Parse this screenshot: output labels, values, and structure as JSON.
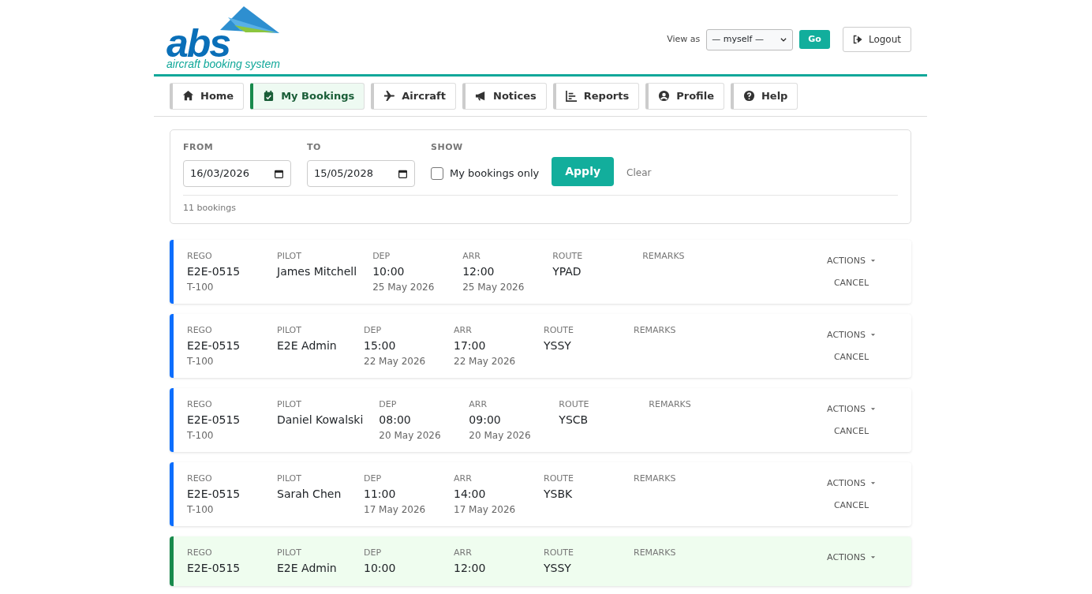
{
  "logo": {
    "mark": "abs",
    "tagline": "aircraft booking system"
  },
  "header": {
    "view_as_label": "View as",
    "view_as_value": "— myself —",
    "go": "Go",
    "logout": "Logout"
  },
  "tabs": [
    {
      "label": "Home",
      "selected": false
    },
    {
      "label": "My Bookings",
      "selected": true
    },
    {
      "label": "Aircraft",
      "selected": false
    },
    {
      "label": "Notices",
      "selected": false
    },
    {
      "label": "Reports",
      "selected": false
    },
    {
      "label": "Profile",
      "selected": false
    },
    {
      "label": "Help",
      "selected": false
    }
  ],
  "filters": {
    "from_label": "FROM",
    "from_value": "16/03/2026",
    "to_label": "TO",
    "to_value": "15/05/2028",
    "show_label": "SHOW",
    "my_bookings_only": {
      "label": "My bookings only",
      "checked": false
    },
    "apply": "Apply",
    "clear": "Clear",
    "count": "11 bookings"
  },
  "bookings": [
    {
      "labels": [
        "REGO",
        "PILOT",
        "DEP",
        "ARR",
        "ROUTE",
        "REMARKS"
      ],
      "rego": "E2E-0515",
      "type": "T-100",
      "pilot": "James Mitchell",
      "dep_time": "10:00",
      "dep_date": "25 May 2026",
      "arr_time": "12:00",
      "arr_date": "25 May 2026",
      "route": "YPAD",
      "own": false,
      "actions": "ACTIONS",
      "cancel": "CANCEL"
    },
    {
      "labels": [
        "REGO",
        "PILOT",
        "DEP",
        "ARR",
        "ROUTE",
        "REMARKS"
      ],
      "rego": "E2E-0515",
      "type": "T-100",
      "pilot": "E2E Admin",
      "dep_time": "15:00",
      "dep_date": "22 May 2026",
      "arr_time": "17:00",
      "arr_date": "22 May 2026",
      "route": "YSSY",
      "own": false,
      "actions": "ACTIONS",
      "cancel": "CANCEL"
    },
    {
      "labels": [
        "REGO",
        "PILOT",
        "DEP",
        "ARR",
        "ROUTE",
        "REMARKS"
      ],
      "rego": "E2E-0515",
      "type": "T-100",
      "pilot": "Daniel Kowalski",
      "dep_time": "08:00",
      "dep_date": "20 May 2026",
      "arr_time": "09:00",
      "arr_date": "20 May 2026",
      "route": "YSCB",
      "own": false,
      "actions": "ACTIONS",
      "cancel": "CANCEL"
    },
    {
      "labels": [
        "REGO",
        "PILOT",
        "DEP",
        "ARR",
        "ROUTE",
        "REMARKS"
      ],
      "rego": "E2E-0515",
      "type": "T-100",
      "pilot": "Sarah Chen",
      "dep_time": "11:00",
      "dep_date": "17 May 2026",
      "arr_time": "14:00",
      "arr_date": "17 May 2026",
      "route": "YSBK",
      "own": false,
      "actions": "ACTIONS",
      "cancel": "CANCEL"
    },
    {
      "labels": [
        "REGO",
        "PILOT",
        "DEP",
        "ARR",
        "ROUTE",
        "REMARKS"
      ],
      "rego": "E2E-0515",
      "pilot": "E2E Admin",
      "dep_time": "10:00",
      "arr_time": "12:00",
      "route": "YSSY",
      "own": true,
      "actions": "ACTIONS"
    }
  ]
}
